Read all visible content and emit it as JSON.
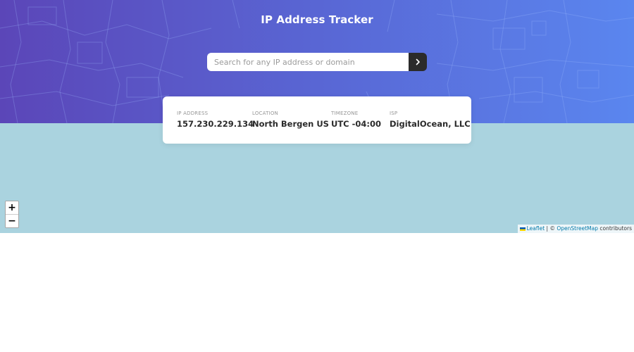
{
  "header": {
    "title": "IP Address Tracker",
    "gradient_start": "#5b46b8",
    "gradient_end": "#5a86ef"
  },
  "search": {
    "placeholder": "Search for any IP address or domain",
    "value": "",
    "button_icon": "chevron-right-icon"
  },
  "info": {
    "ip": {
      "label": "IP ADDRESS",
      "value": "157.230.229.134"
    },
    "location": {
      "label": "LOCATION",
      "value": "North Bergen US"
    },
    "timezone": {
      "label": "TIMEZONE",
      "value": "UTC -04:00"
    },
    "isp": {
      "label": "ISP",
      "value": "DigitalOcean, LLC"
    }
  },
  "map": {
    "background": "#aad3df",
    "zoom_in": "+",
    "zoom_out": "−",
    "attribution": {
      "leaflet": "Leaflet",
      "separator": " | © ",
      "osm": "OpenStreetMap",
      "suffix": " contributors"
    }
  }
}
